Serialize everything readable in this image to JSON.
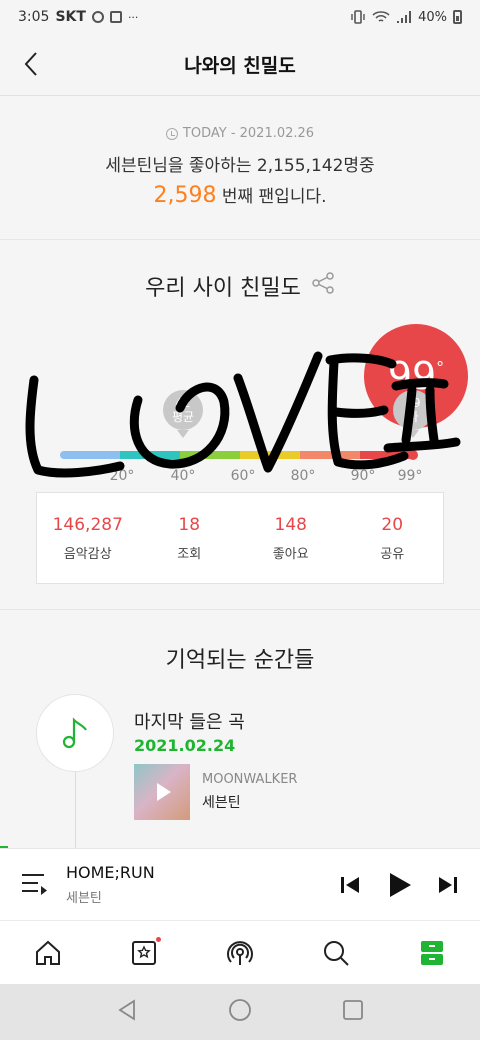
{
  "status_bar": {
    "time": "3:05",
    "carrier": "SKT",
    "dots": "···",
    "battery": "40%"
  },
  "header": {
    "title": "나와의 친밀도",
    "back_icon": "chevron-left-icon"
  },
  "today": {
    "date_label": "TODAY - 2021.02.26",
    "line1": "세븐틴님을 좋아하는 2,155,142명중",
    "rank": "2,598",
    "rank_suffix": " 번째 팬입니다."
  },
  "closeness": {
    "title": "우리 사이 친밀도",
    "score": "99",
    "score_unit": "°",
    "avg_pin": {
      "value": "42",
      "label": "평균"
    },
    "my_pin": {
      "value": "99",
      "label": "나"
    },
    "ticks": [
      "20°",
      "40°",
      "60°",
      "80°",
      "90°",
      "99°"
    ],
    "gauge_level": 99,
    "colors": {
      "accent": "#e8474a",
      "orange": "#ff7f1e",
      "green": "#1fb431"
    },
    "stats": [
      {
        "value": "146,287",
        "label": "음악감상"
      },
      {
        "value": "18",
        "label": "조회"
      },
      {
        "value": "148",
        "label": "좋아요"
      },
      {
        "value": "20",
        "label": "공유"
      }
    ]
  },
  "memories": {
    "title": "기억되는 순간들",
    "item": {
      "label": "마지막 들은 곡",
      "date": "2021.02.24",
      "song_title": "MOONWALKER",
      "artist": "세븐틴"
    }
  },
  "player": {
    "title": "HOME;RUN",
    "artist": "세븐틴"
  },
  "bottom_nav": [
    "home-icon",
    "my-music-icon",
    "podcast-icon",
    "search-icon",
    "drawer-icon"
  ],
  "system_nav": [
    "back-icon",
    "home-circle-icon",
    "recents-icon"
  ]
}
